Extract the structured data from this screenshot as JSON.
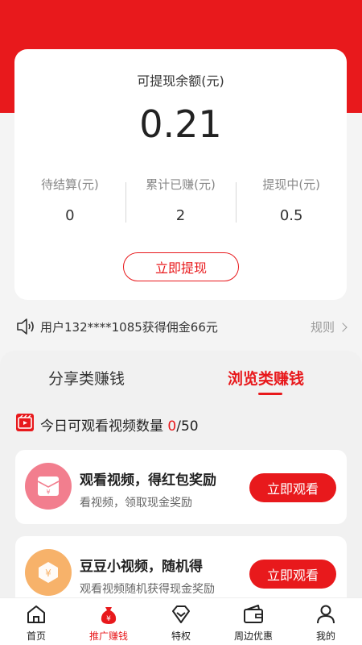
{
  "balance": {
    "label": "可提现余额(元)",
    "amount": "0.21",
    "stats": [
      {
        "label": "待结算(元)",
        "value": "0"
      },
      {
        "label": "累计已赚(元)",
        "value": "2"
      },
      {
        "label": "提现中(元)",
        "value": "0.5"
      }
    ],
    "withdraw_button": "立即提现"
  },
  "notice": {
    "text": "用户132****1085获得佣金66元",
    "rules_label": "规则"
  },
  "tabs": {
    "share": "分享类赚钱",
    "browse": "浏览类赚钱"
  },
  "video_count": {
    "label": "今日可观看视频数量",
    "current": "0",
    "total": "/50"
  },
  "tasks": [
    {
      "title": "观看视频，得红包奖励",
      "subtitle": "看视频，领取现金奖励",
      "button": "立即观看",
      "icon": "red-envelope-icon"
    },
    {
      "title": "豆豆小视频，随机得",
      "subtitle": "观看视频随机获得现金奖励",
      "button": "立即观看",
      "icon": "coin-icon"
    }
  ],
  "tabbar": [
    {
      "label": "首页",
      "icon": "home-icon"
    },
    {
      "label": "推广赚钱",
      "icon": "money-bag-icon",
      "active": true
    },
    {
      "label": "特权",
      "icon": "diamond-icon"
    },
    {
      "label": "周边优惠",
      "icon": "wallet-icon"
    },
    {
      "label": "我的",
      "icon": "user-icon"
    }
  ],
  "colors": {
    "accent": "#e8191c"
  }
}
